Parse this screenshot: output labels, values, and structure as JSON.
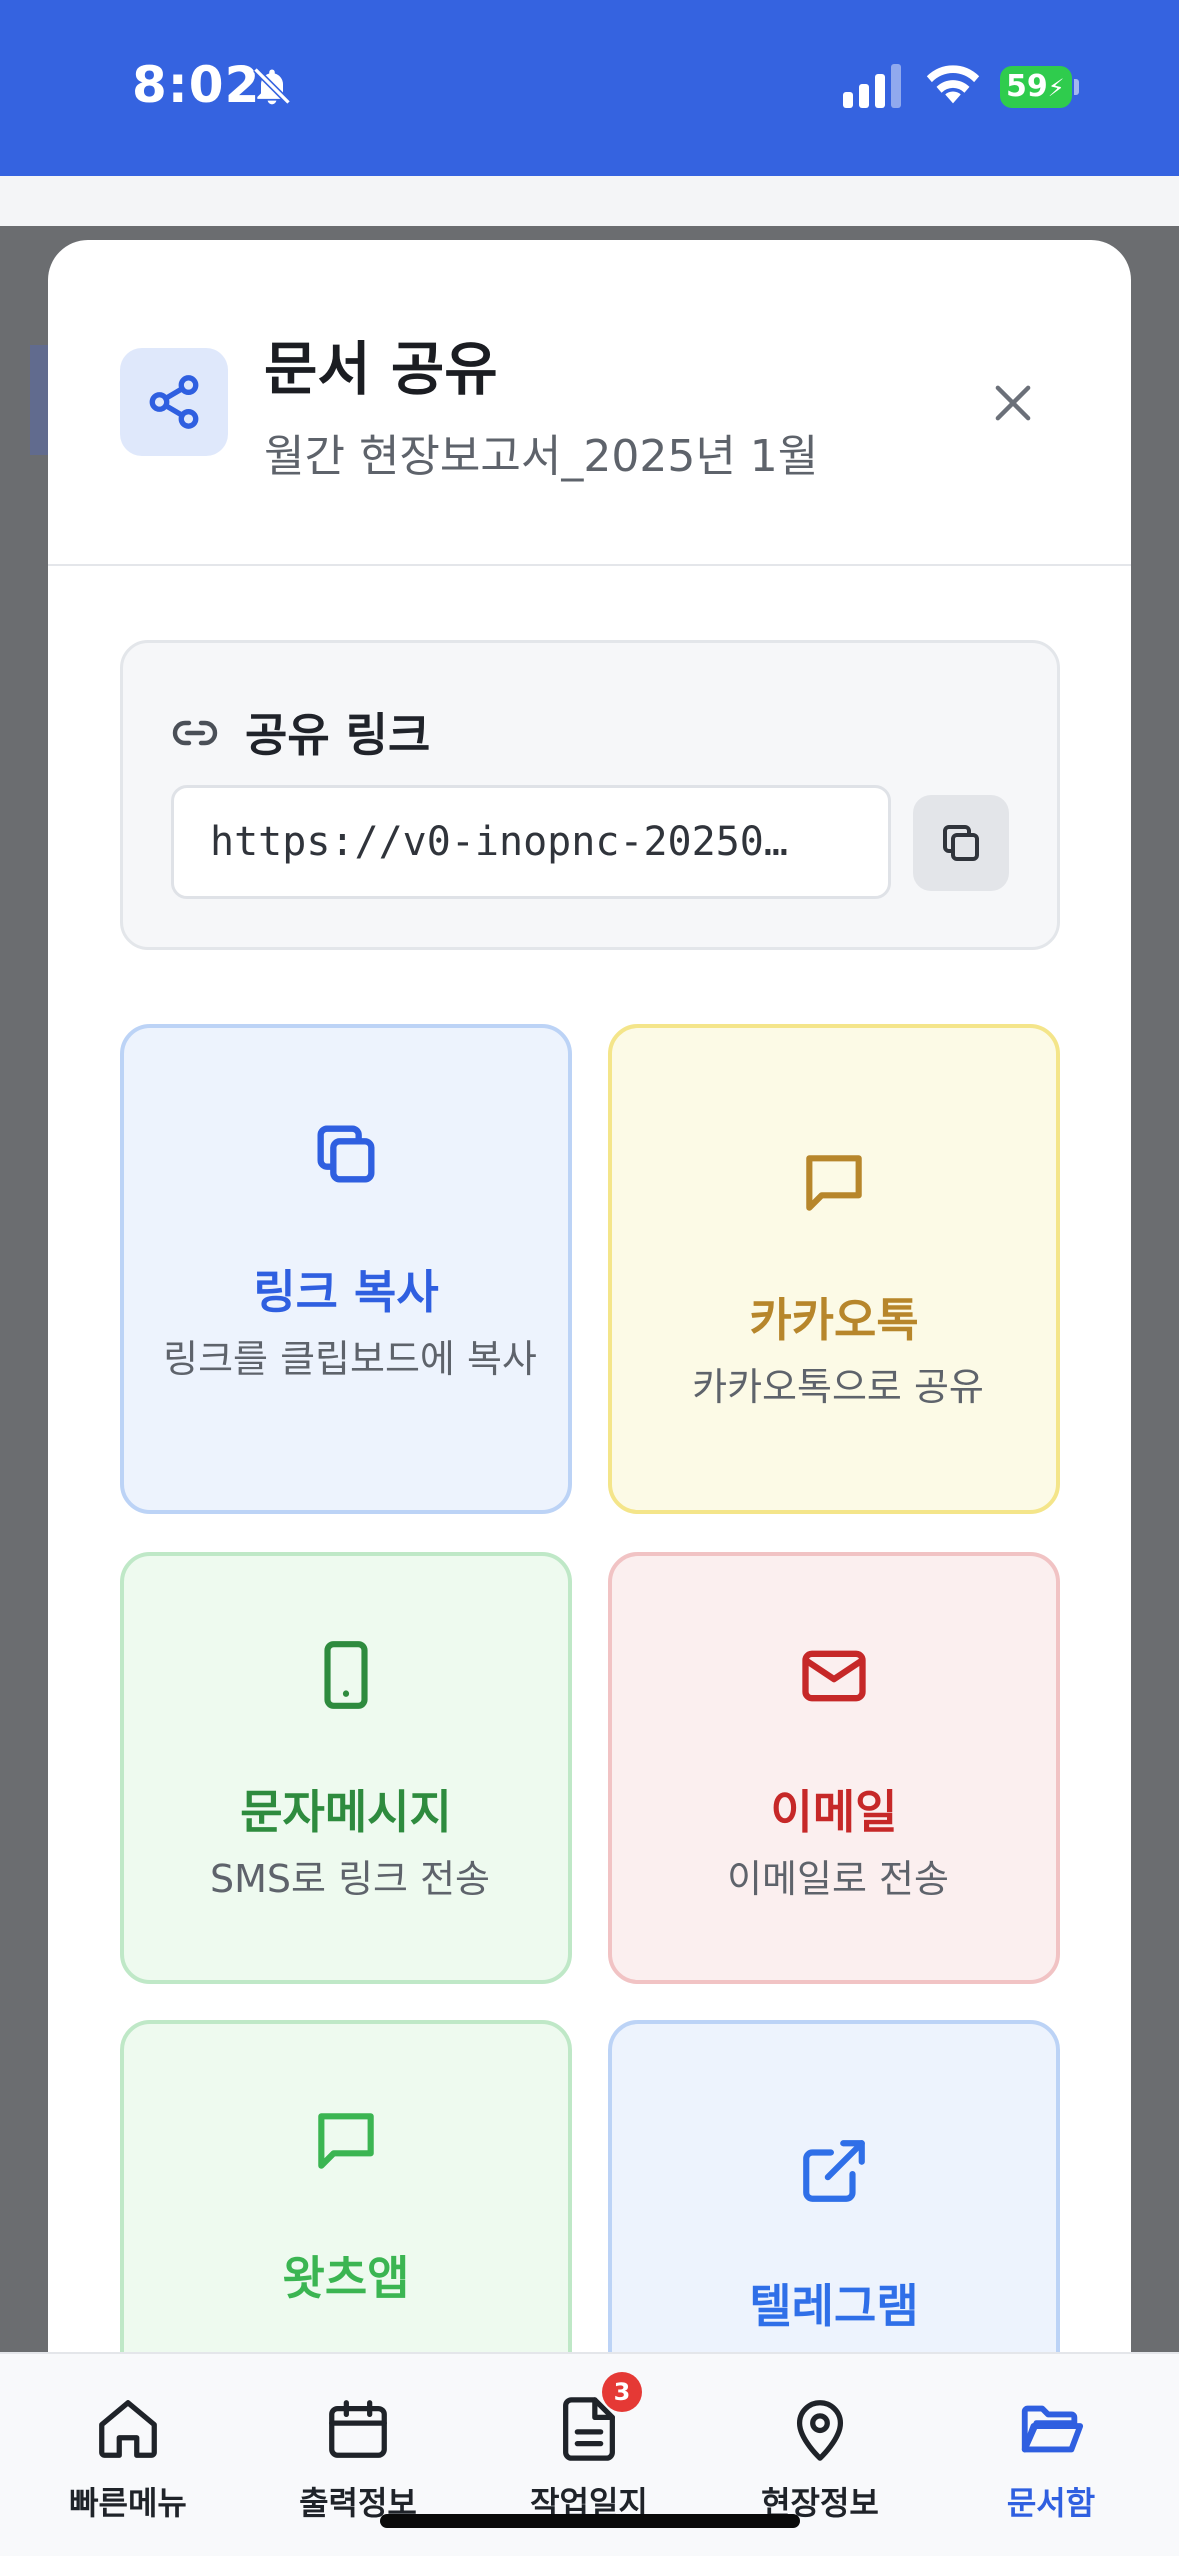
{
  "status_bar": {
    "time": "8:02",
    "battery": "59",
    "bar_color": "#3563e0"
  },
  "modal": {
    "title": "문서 공유",
    "subtitle": "월간 현장보고서_2025년 1월",
    "header_icon": "share-icon",
    "close_icon": "close-icon"
  },
  "share_link": {
    "label": "공유 링크",
    "value": "https://v0-inopnc-20250…",
    "copy_icon": "copy-icon"
  },
  "options": [
    {
      "title": "링크 복사",
      "desc": "링크를 클립보드에 복사",
      "icon": "copy-icon",
      "color": "#2f5fe0"
    },
    {
      "title": "카카오톡",
      "desc": "카카오톡으로 공유",
      "icon": "message-icon",
      "color": "#b7862b"
    },
    {
      "title": "문자메시지",
      "desc": "SMS로 링크 전송",
      "icon": "phone-icon",
      "color": "#2e8b3e"
    },
    {
      "title": "이메일",
      "desc": "이메일로 전송",
      "icon": "mail-icon",
      "color": "#c62828"
    },
    {
      "title": "왓츠앱",
      "desc": "",
      "icon": "message-icon",
      "color": "#3bb552"
    },
    {
      "title": "텔레그램",
      "desc": "",
      "icon": "external-link-icon",
      "color": "#2f6fe8"
    }
  ],
  "nav": [
    {
      "label": "빠른메뉴",
      "icon": "home-icon",
      "active": false
    },
    {
      "label": "출력정보",
      "icon": "calendar-icon",
      "active": false
    },
    {
      "label": "작업일지",
      "icon": "document-icon",
      "active": false,
      "badge": "3"
    },
    {
      "label": "현장정보",
      "icon": "location-icon",
      "active": false
    },
    {
      "label": "문서함",
      "icon": "folder-icon",
      "active": true
    }
  ]
}
